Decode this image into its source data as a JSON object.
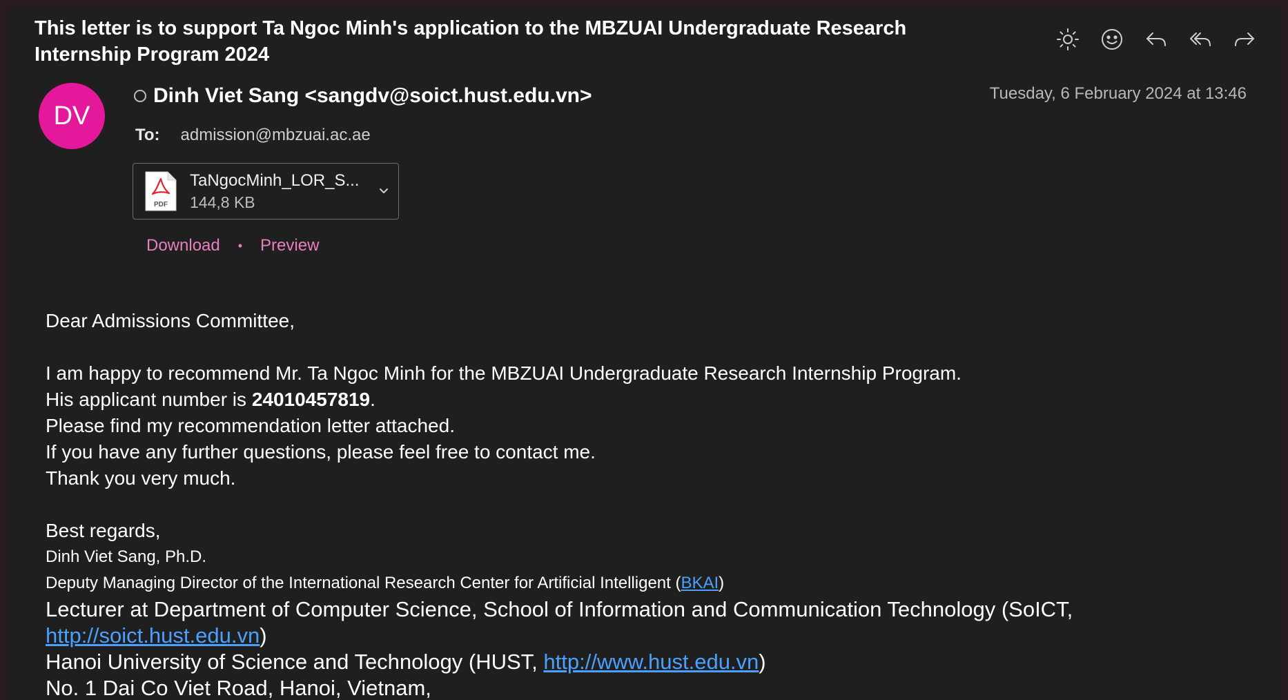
{
  "email": {
    "subject": "This letter is to support Ta Ngoc Minh's application to the MBZUAI Undergraduate Research Internship Program 2024",
    "avatar_initials": "DV",
    "sender": "Dinh Viet Sang <sangdv@soict.hust.edu.vn>",
    "date": "Tuesday, 6 February 2024 at 13:46",
    "to_label": "To:",
    "to_address": "admission@mbzuai.ac.ae"
  },
  "toolbar": {
    "icons": [
      "brightness-icon",
      "emoji-icon",
      "reply-icon",
      "reply-all-icon",
      "forward-icon"
    ]
  },
  "attachment": {
    "name": "TaNgocMinh_LOR_S...",
    "size": "144,8 KB",
    "type_label": "PDF",
    "download": "Download",
    "separator": "•",
    "preview": "Preview"
  },
  "body": {
    "greeting": "Dear Admissions Committee,",
    "line1": "I am happy to recommend Mr. Ta Ngoc Minh for the MBZUAI Undergraduate Research Internship Program.",
    "line2_prefix": "His applicant number is ",
    "applicant_number": "24010457819",
    "line2_suffix": ".",
    "line3": "Please find my recommendation letter attached.",
    "line4": "If you have any further questions, please feel free to contact me.",
    "line5": "Thank you very much.",
    "closing": "Best regards,"
  },
  "signature": {
    "name": "Dinh Viet Sang,  Ph.D.",
    "role_prefix": "Deputy Managing Director of the International Research Center for Artificial Intelligent (",
    "role_link": "BKAI",
    "role_suffix": ")",
    "lecturer_prefix": "Lecturer at Department of Computer Science, School of Information and Communication Technology (SoICT,",
    "soict_link": "http://soict.hust.edu.vn",
    "soict_suffix": ")",
    "hust_prefix": "Hanoi University of Science and Technology (HUST, ",
    "hust_link": "http://www.hust.edu.vn",
    "hust_suffix": ")",
    "address": "No. 1 Dai Co Viet Road, Hanoi, Vietnam,"
  },
  "colors": {
    "background": "#1f1f1f",
    "avatar": "#e3189a",
    "link": "#4aa0ff",
    "accent_link": "#e97fbf"
  }
}
